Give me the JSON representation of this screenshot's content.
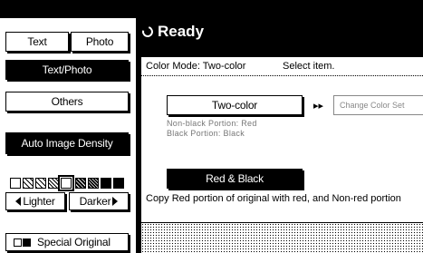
{
  "status": {
    "text": "Ready"
  },
  "left_panel": {
    "text_label": "Text",
    "photo_label": "Photo",
    "text_photo_label": "Text/Photo",
    "others_label": "Others",
    "auto_density_label": "Auto Image Density",
    "lighter_label": "Lighter",
    "darker_label": "Darker",
    "special_original_label": "Special Original"
  },
  "main": {
    "color_mode_label": "Color Mode: Two-color",
    "select_prompt": "Select item.",
    "two_color_button": "Two-color",
    "change_color_button": "Change Color Set",
    "non_black_portion": "Non-black Portion: Red",
    "black_portion": "Black Portion: Black",
    "red_black_button": "Red & Black",
    "description": "Copy Red portion of original with red, and  Non-red portion"
  },
  "icons": {
    "status": "ready-ring-icon",
    "arrow": "right-arrow-icon"
  },
  "colors": {
    "background": "#000000",
    "panel": "#ffffff",
    "disabled_text": "#888888"
  }
}
